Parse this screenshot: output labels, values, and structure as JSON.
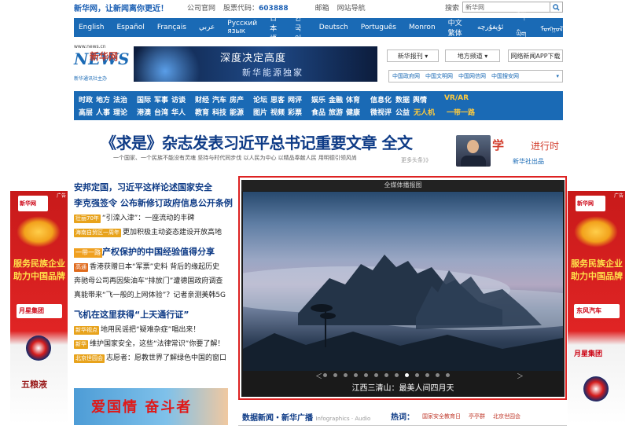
{
  "topbar": {
    "slogan": "新华网，让新闻离你更近！",
    "links": [
      "公司官网",
      "股票代码：",
      "603888",
      "邮箱",
      "网站导航",
      "搜索"
    ],
    "search_placeholder": "新华网"
  },
  "langbar": {
    "items": [
      "English",
      "Español",
      "Français",
      "عربي",
      "Русский язык",
      "日本語",
      "한국어",
      "Deutsch",
      "Português",
      "Monron",
      "中文繁体",
      "ئۇيغۇرچە",
      "བོད་ཡིག",
      "ᠮᠣᠩᠭᠣᠯ"
    ]
  },
  "header": {
    "logo_url": "www.news.cn",
    "logo_word": "NEWS",
    "logo_cn": "新华网",
    "logo_tag": "新华通讯社主办",
    "banner_t1": "深度决定高度",
    "banner_t2": "新华能源独家",
    "select1": "新华报刊",
    "select2": "地方频道",
    "app_button": "网络新闻APP下载",
    "links": [
      "中国政府网",
      "中国文明网",
      "中国网信网",
      "中国搜安网"
    ]
  },
  "nav": {
    "row1": [
      "时政",
      "地方",
      "法治",
      "",
      "国际",
      "军事",
      "访谈",
      "",
      "财经",
      "汽车",
      "房产",
      "",
      "论坛",
      "思客",
      "网评",
      "",
      "娱乐",
      "金融",
      "体育",
      "",
      "信息化",
      "数据",
      "舆情",
      "",
      "VR/AR"
    ],
    "row2": [
      "高层",
      "人事",
      "理论",
      "",
      "港澳",
      "台湾",
      "华人",
      "",
      "教育",
      "科技",
      "能源",
      "",
      "图片",
      "视频",
      "彩票",
      "",
      "食品",
      "旅游",
      "健康",
      "",
      "微视评",
      "公益",
      "无人机",
      "",
      "一带一路"
    ]
  },
  "headline": {
    "title": "《求是》杂志发表习近平总书记重要文章 全文",
    "subline": "一个国家、一个民族不能没有灵魂 坚持与时代同步伐 以人民为中心 以精品奉献人民 用明德引领风尚",
    "more": "更多头条》》"
  },
  "xi": {
    "xue": "学",
    "jxs": "进行时",
    "she": "新华社出品"
  },
  "news": {
    "h1": "安邦定国，习近平这样论述国家安全",
    "h2": "李克强签令 公布新修订政府信息公开条例",
    "l1_tag": "壮丽70年",
    "l1": "“引滦入津”：一座流动的丰碑",
    "l2_tag": "海南自贸区一周年",
    "l2": "更加积极主动姿态建设开放高地",
    "h3_tag": "一带一路",
    "h3": "产权保护的中国经验值得分享",
    "l3_tag": "高通",
    "l3": "香港获赠日本“军票”史料 背后的缘起历史",
    "l4": "奔驰母公司再因柴油车“排放门”遭德国政府调查",
    "l5": "真能带来“飞一般的上网体验”？记者亲测美韩5G",
    "h4": "飞机在这里获得“上天通行证”",
    "l6_tag": "新华视点",
    "l6": "地用民谣把“疑难杂症”唱出来！",
    "l7_tag": "新华",
    "l7": "维护国家安全，这些“法律常识”你要了解！",
    "l8_tag": "北京世园会",
    "l8": "志愿者：愿教世界了解绿色中国的窗口",
    "banner": "爱国情 奋斗者"
  },
  "slideshow": {
    "header": "全媒体播报图",
    "caption": "江西三清山：最美人间四月天",
    "dot_count": 13,
    "active_dot": 8,
    "prev": "＜",
    "next": "＞"
  },
  "bottom": {
    "left": "数据新闻・新华广播",
    "left_sub": "Infographics · Audio",
    "hot": "热词：",
    "hot_items": [
      "国家安全教育日",
      "亭亭群",
      "北京世园会"
    ]
  },
  "sidead_left": {
    "ad": "广告",
    "badge": "新华网",
    "w1": "服务民族企业",
    "w2": "助力中国品牌",
    "logo": "月星集团",
    "bottom": "五粮液"
  },
  "sidead_right": {
    "ad": "广告",
    "badge": "新华网",
    "w1": "服务民族企业",
    "w2": "助力中国品牌",
    "logo": "东风汽车",
    "brand": "月星集团"
  },
  "colors": {
    "brand_blue": "#1a6ab5",
    "headline_navy": "#0e3b86",
    "accent_red": "#d22222"
  }
}
